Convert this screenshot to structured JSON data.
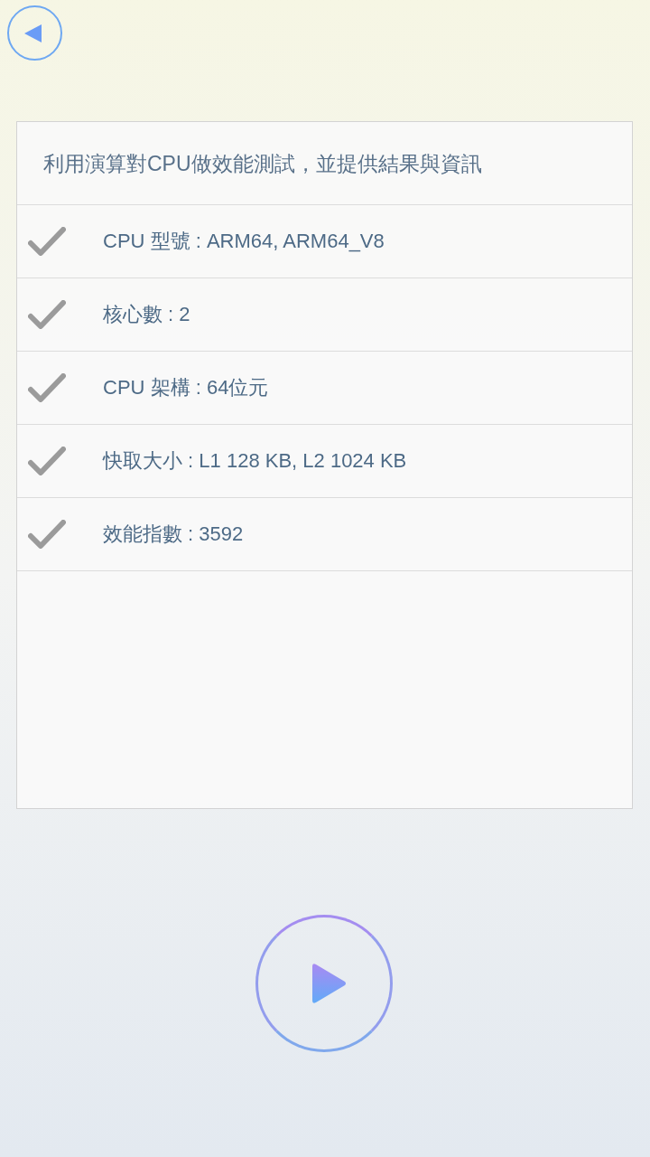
{
  "card": {
    "description": "利用演算對CPU做效能測試，並提供結果與資訊",
    "items": [
      {
        "label": "CPU 型號 : ARM64, ARM64_V8",
        "checked": true
      },
      {
        "label": "核心數 : 2",
        "checked": true
      },
      {
        "label": "CPU 架構 : 64位元",
        "checked": true
      },
      {
        "label": "快取大小 : L1 128 KB, L2 1024 KB",
        "checked": true
      },
      {
        "label": "效能指數 : 3592",
        "checked": true
      }
    ]
  }
}
